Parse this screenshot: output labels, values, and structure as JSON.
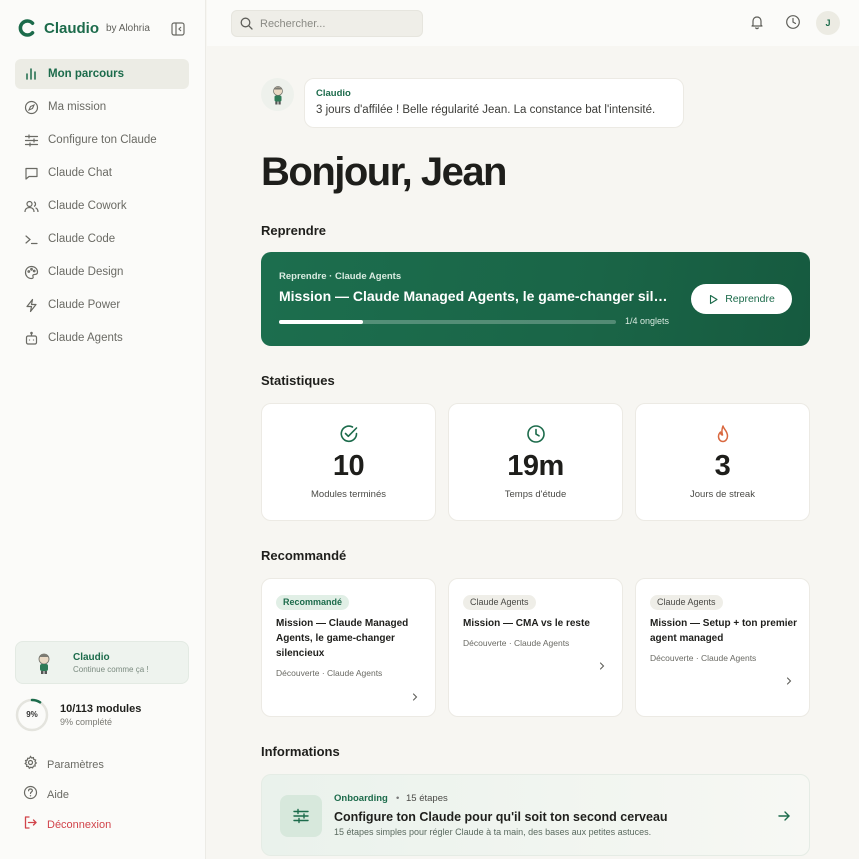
{
  "brand": {
    "name": "Claudio",
    "by": "by Alohria"
  },
  "sidebar": {
    "items": [
      {
        "label": "Mon parcours",
        "icon": "bar-chart-icon"
      },
      {
        "label": "Ma mission",
        "icon": "compass-icon"
      },
      {
        "label": "Configure ton Claude",
        "icon": "sliders-icon"
      },
      {
        "label": "Claude Chat",
        "icon": "chat-icon"
      },
      {
        "label": "Claude Cowork",
        "icon": "users-icon"
      },
      {
        "label": "Claude Code",
        "icon": "terminal-icon"
      },
      {
        "label": "Claude Design",
        "icon": "palette-icon"
      },
      {
        "label": "Claude Power",
        "icon": "bolt-icon"
      },
      {
        "label": "Claude Agents",
        "icon": "robot-icon"
      }
    ],
    "claudio_card": {
      "name": "Claudio",
      "subtitle": "Continue comme ça !"
    },
    "progress": {
      "ring_label": "9%",
      "percent": 9,
      "title": "10/113 modules",
      "subtitle": "9% complété"
    },
    "bottom": [
      {
        "label": "Paramètres",
        "icon": "gear-icon"
      },
      {
        "label": "Aide",
        "icon": "help-icon"
      },
      {
        "label": "Déconnexion",
        "icon": "logout-icon"
      }
    ]
  },
  "topbar": {
    "search_placeholder": "Rechercher...",
    "user_initial": "J"
  },
  "message": {
    "name": "Claudio",
    "text": "3 jours d'affilée ! Belle régularité Jean. La constance bat l'intensité."
  },
  "greeting": "Bonjour, Jean",
  "sections": {
    "resume": "Reprendre",
    "stats": "Statistiques",
    "recommended": "Recommandé",
    "info": "Informations"
  },
  "resume_card": {
    "label": "Reprendre · Claude Agents",
    "title": "Mission — Claude Managed Agents, le game-changer silencieux",
    "progress": 0.25,
    "count": "1/4 onglets",
    "button": "Reprendre"
  },
  "stats": [
    {
      "value": "10",
      "label": "Modules terminés",
      "icon": "check-circle-icon"
    },
    {
      "value": "19m",
      "label": "Temps d'étude",
      "icon": "clock-icon"
    },
    {
      "value": "3",
      "label": "Jours de streak",
      "icon": "flame-icon"
    }
  ],
  "recommended": [
    {
      "badge": "Recommandé",
      "title": "Mission — Claude Managed Agents, le game-changer silencieux",
      "meta": "Découverte · Claude Agents"
    },
    {
      "badge": "Claude Agents",
      "title": "Mission — CMA vs le reste",
      "meta": "Découverte · Claude Agents"
    },
    {
      "badge": "Claude Agents",
      "title": "Mission — Setup + ton premier agent managed",
      "meta": "Découverte · Claude Agents"
    }
  ],
  "info_card": {
    "tag": "Onboarding",
    "dot": "•",
    "steps": "15 étapes",
    "title": "Configure ton Claude pour qu'il soit ton second cerveau",
    "subtitle": "15 étapes simples pour régler Claude à ta main, des bases aux petites astuces."
  },
  "colors": {
    "accent": "#1c6b4b",
    "danger": "#d1434a",
    "flame": "#d9683f"
  }
}
